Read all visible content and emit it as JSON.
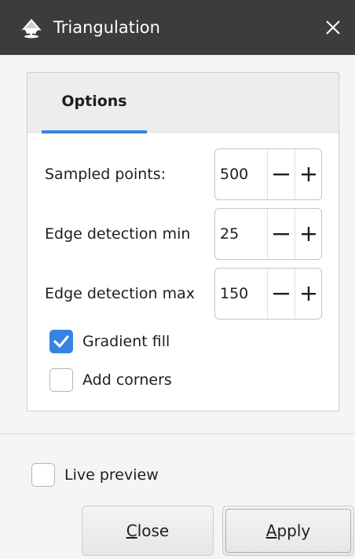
{
  "window": {
    "title": "Triangulation",
    "colors": {
      "titlebar": "#3c3c3c",
      "accent": "#3584e4"
    },
    "icons": {
      "app": "inkscape-logo-icon",
      "close": "close-icon"
    }
  },
  "tabs": [
    {
      "label": "Options",
      "selected": true
    }
  ],
  "fields": [
    {
      "label": "Sampled points:",
      "value": "500"
    },
    {
      "label": "Edge detection min",
      "value": "25"
    },
    {
      "label": "Edge detection max",
      "value": "150"
    }
  ],
  "checkboxes": [
    {
      "label": "Gradient fill",
      "checked": true
    },
    {
      "label": "Add corners",
      "checked": false
    }
  ],
  "live_preview": {
    "label": "Live preview",
    "checked": false
  },
  "buttons": {
    "close": {
      "mnemonic": "C",
      "rest": "lose"
    },
    "apply": {
      "mnemonic": "A",
      "rest": "pply"
    }
  }
}
